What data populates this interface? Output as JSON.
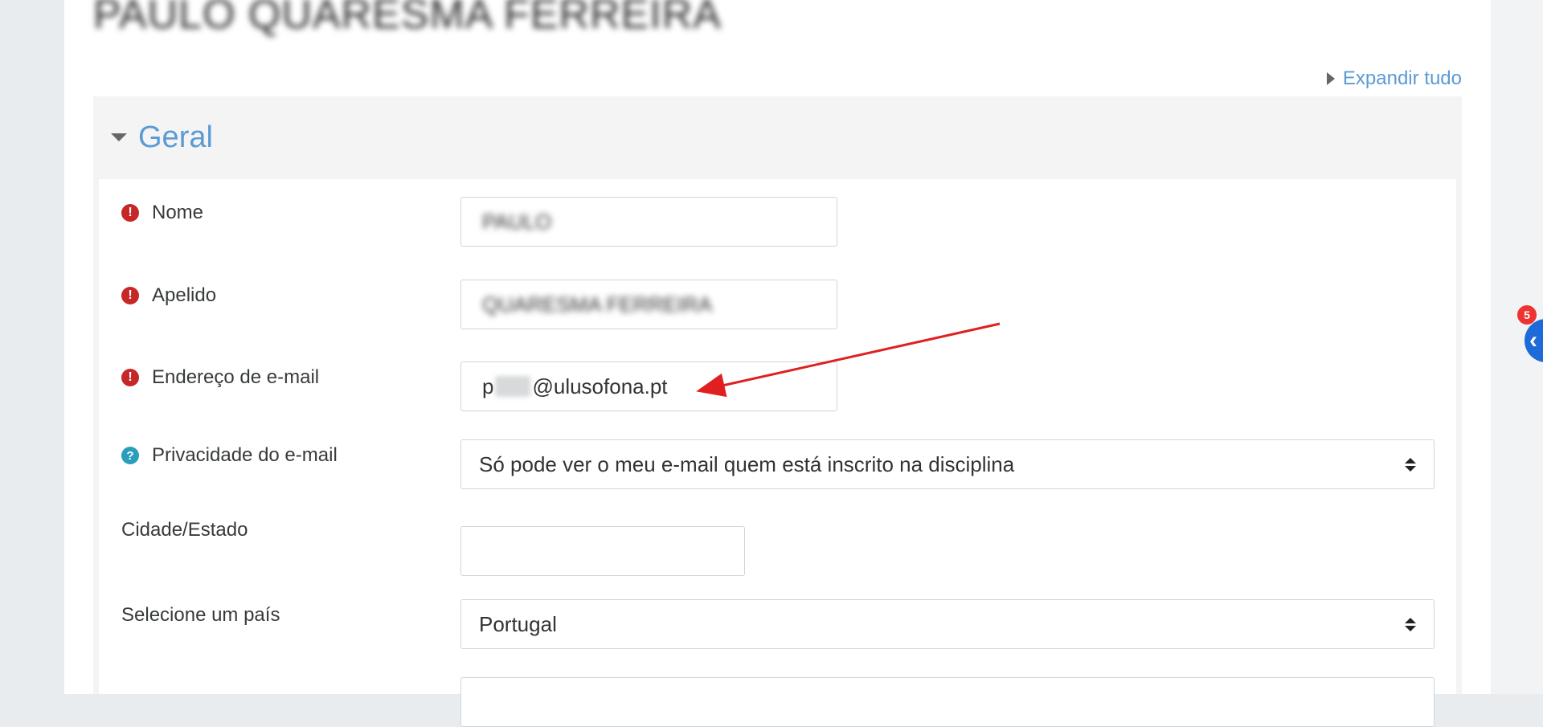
{
  "page": {
    "title": "PAULO QUARESMA FERREIRA"
  },
  "actions": {
    "expand_all": "Expandir tudo"
  },
  "section": {
    "title": "Geral"
  },
  "form": {
    "first_name": {
      "label": "Nome",
      "value": "PAULO"
    },
    "last_name": {
      "label": "Apelido",
      "value": "QUARESMA FERREIRA"
    },
    "email": {
      "label": "Endereço de e-mail",
      "prefix": "p",
      "suffix": "@ulusofona.pt"
    },
    "email_privacy": {
      "label": "Privacidade do e-mail",
      "value": "Só pode ver o meu e-mail quem está inscrito na disciplina"
    },
    "city": {
      "label": "Cidade/Estado",
      "value": ""
    },
    "country": {
      "label": "Selecione um país",
      "value": "Portugal"
    }
  },
  "widget": {
    "badge_count": "5",
    "icon": "chevron-left-icon"
  },
  "colors": {
    "link": "#5b9bd5",
    "required": "#c62828",
    "help": "#2a9fbc",
    "annotation_arrow": "#e02020"
  }
}
